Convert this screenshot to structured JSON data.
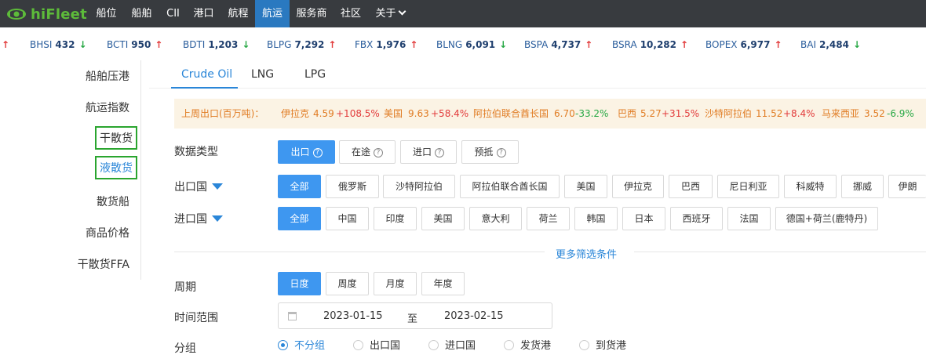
{
  "nav": {
    "brand": "hiFleet",
    "items": [
      "船位",
      "船舶",
      "CII",
      "港口",
      "航程",
      "航运",
      "服务商",
      "社区",
      "关于"
    ],
    "active": "航运"
  },
  "ticker": [
    {
      "name": "BHSI",
      "value": "432",
      "dir": "down"
    },
    {
      "name": "BCTI",
      "value": "950",
      "dir": "up"
    },
    {
      "name": "BDTI",
      "value": "1,203",
      "dir": "down"
    },
    {
      "name": "BLPG",
      "value": "7,292",
      "dir": "up"
    },
    {
      "name": "FBX",
      "value": "1,976",
      "dir": "up"
    },
    {
      "name": "BLNG",
      "value": "6,091",
      "dir": "down"
    },
    {
      "name": "BSPA",
      "value": "4,737",
      "dir": "up"
    },
    {
      "name": "BSRA",
      "value": "10,282",
      "dir": "up"
    },
    {
      "name": "BOPEX",
      "value": "6,977",
      "dir": "up"
    },
    {
      "name": "BAI",
      "value": "2,484",
      "dir": "down"
    }
  ],
  "sidebar": {
    "items": [
      "船舶压港",
      "航运指数",
      "干散货",
      "液散货",
      "散货船",
      "商品价格",
      "干散货FFA"
    ]
  },
  "tabs": {
    "items": [
      "Crude Oil",
      "LNG",
      "LPG"
    ],
    "active": "Crude Oil"
  },
  "export_banner": {
    "label": "上周出口(百万吨)：",
    "entries": [
      {
        "country": "伊拉克",
        "value": "4.59",
        "change": "+108.5%"
      },
      {
        "country": "美国",
        "value": "9.63",
        "change": "+58.4%"
      },
      {
        "country": "阿拉伯联合酋长国",
        "value": "6.70",
        "change": "-33.2%"
      },
      {
        "country": "巴西",
        "value": "5.27",
        "change": "+31.5%"
      },
      {
        "country": "沙特阿拉伯",
        "value": "11.52",
        "change": "+8.4%"
      },
      {
        "country": "马来西亚",
        "value": "3.52",
        "change": "-6.9%"
      }
    ]
  },
  "data_type": {
    "label": "数据类型",
    "options": [
      "出口",
      "在途",
      "进口",
      "预抵"
    ],
    "selected": "出口",
    "help_icon": "question-circle-icon"
  },
  "export_country": {
    "label": "出口国",
    "options": [
      "全部",
      "俄罗斯",
      "沙特阿拉伯",
      "阿拉伯联合酋长国",
      "美国",
      "伊拉克",
      "巴西",
      "尼日利亚",
      "科威特",
      "挪威",
      "伊朗"
    ],
    "selected": "全部"
  },
  "import_country": {
    "label": "进口国",
    "options": [
      "全部",
      "中国",
      "印度",
      "美国",
      "意大利",
      "荷兰",
      "韩国",
      "日本",
      "西班牙",
      "法国",
      "德国+荷兰(鹿特丹)"
    ],
    "selected": "全部"
  },
  "more_filters": "更多筛选条件",
  "period": {
    "label": "周期",
    "options": [
      "日度",
      "周度",
      "月度",
      "年度"
    ],
    "selected": "日度"
  },
  "time_range": {
    "label": "时间范围",
    "start": "2023-01-15",
    "separator": "至",
    "end": "2023-02-15"
  },
  "grouping": {
    "label": "分组",
    "options": [
      "不分组",
      "出口国",
      "进口国",
      "发货港",
      "到货港"
    ],
    "selected": "不分组"
  },
  "colors": {
    "nav_bg": "#383b3f",
    "accent": "#2a86d8",
    "brand_green": "#5dbb3a",
    "up": "#e23b3b",
    "down": "#27a844",
    "banner_bg": "#fbf3e4",
    "highlight_box": "#2aa52f"
  }
}
